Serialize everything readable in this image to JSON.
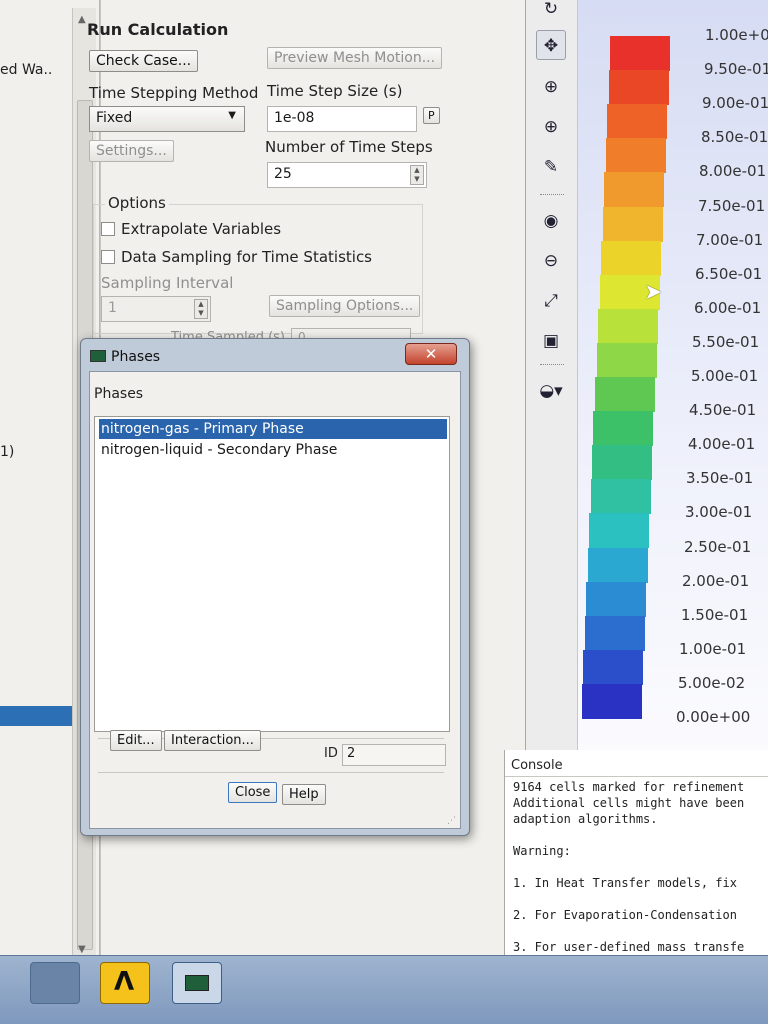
{
  "left_tree": {
    "item_fragment_1": "ed Wa..",
    "item_fragment_2": "1)"
  },
  "run_calculation": {
    "title": "Run Calculation",
    "check_case_label": "Check Case...",
    "preview_mesh_motion_label": "Preview Mesh Motion...",
    "time_stepping_method_label": "Time Stepping Method",
    "time_stepping_method_value": "Fixed",
    "time_step_size_label": "Time Step Size (s)",
    "time_step_size_value": "1e-08",
    "param_button_label": "P",
    "settings_label": "Settings...",
    "number_of_time_steps_label": "Number of Time Steps",
    "number_of_time_steps_value": "25",
    "options_label": "Options",
    "extrapolate_variables_label": "Extrapolate Variables",
    "data_sampling_label": "Data Sampling for Time Statistics",
    "sampling_interval_label": "Sampling Interval",
    "sampling_interval_value": "1",
    "sampling_options_label": "Sampling Options...",
    "time_sampled_label": "Time Sampled (s)",
    "time_sampled_value": "0"
  },
  "toolbar": {
    "icons": [
      "rotate-icon",
      "pan-icon",
      "zoom-in-icon",
      "zoom-fit-icon",
      "probe-icon",
      "zoom-box-icon",
      "zoom-out-icon",
      "axes-icon",
      "screenshot-icon",
      "view-options-icon"
    ]
  },
  "colormap": {
    "labels": [
      "1.00e+00",
      "9.50e-01",
      "9.00e-01",
      "8.50e-01",
      "8.00e-01",
      "7.50e-01",
      "7.00e-01",
      "6.50e-01",
      "6.00e-01",
      "5.50e-01",
      "5.00e-01",
      "4.50e-01",
      "4.00e-01",
      "3.50e-01",
      "3.00e-01",
      "2.50e-01",
      "2.00e-01",
      "1.50e-01",
      "1.00e-01",
      "5.00e-02",
      "0.00e+00"
    ],
    "colors": [
      "#e8312b",
      "#ea4727",
      "#ee6228",
      "#f07d2a",
      "#f0992c",
      "#f0b52c",
      "#ecd32a",
      "#dde631",
      "#b8e23a",
      "#8ed746",
      "#5ec852",
      "#3cc068",
      "#33bf84",
      "#30c1a2",
      "#2cc1c1",
      "#2aa8d2",
      "#2b8bd3",
      "#2c6dd0",
      "#2b4fca",
      "#2a32c3"
    ]
  },
  "console": {
    "title": "Console",
    "lines": [
      "9164 cells marked for refinement",
      "Additional cells might have been",
      "adaption algorithms.",
      "",
      "Warning:",
      "",
      "1. In Heat Transfer models, fix",
      "",
      "2. For Evaporation-Condensation",
      "",
      "3. For user-defined mass transfe"
    ]
  },
  "phases_dialog": {
    "title": "Phases",
    "list_label": "Phases",
    "phases": [
      "nitrogen-gas - Primary Phase",
      "nitrogen-liquid - Secondary Phase"
    ],
    "selected_index": 0,
    "edit_label": "Edit...",
    "interaction_label": "Interaction...",
    "id_label": "ID",
    "id_value": "2",
    "close_label": "Close",
    "help_label": "Help",
    "close_icon": "close-icon"
  },
  "taskbar": {
    "apps": [
      "fluent-app",
      "ansys-workbench-app",
      "phases-window-app"
    ]
  }
}
